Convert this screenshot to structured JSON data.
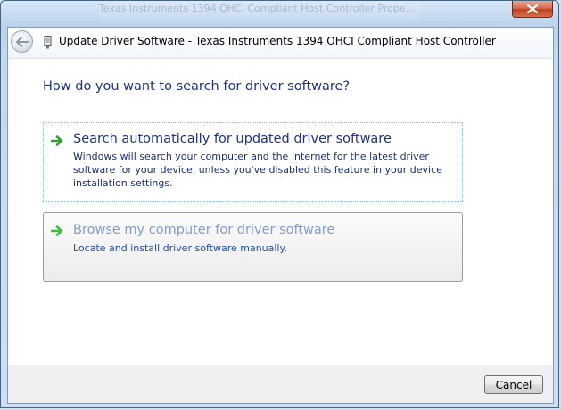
{
  "window": {
    "background_title": "Texas Instruments 1394 OHCI Compliant Host Controller Prope...",
    "title": "Update Driver Software - Texas Instruments 1394 OHCI Compliant Host Controller"
  },
  "main": {
    "heading": "How do you want to search for driver software?"
  },
  "options": [
    {
      "title": "Search automatically for updated driver software",
      "description": "Windows will search your computer and the Internet for the latest driver software for your device, unless you've disabled this feature in your device installation settings.",
      "icon": "green-arrow-icon"
    },
    {
      "title": "Browse my computer for driver software",
      "description": "Locate and install driver software manually.",
      "icon": "green-arrow-icon"
    }
  ],
  "footer": {
    "cancel_label": "Cancel"
  },
  "colors": {
    "heading": "#1e3287",
    "hover_title": "#7f9ec9",
    "arrow": "#2ea12b"
  }
}
